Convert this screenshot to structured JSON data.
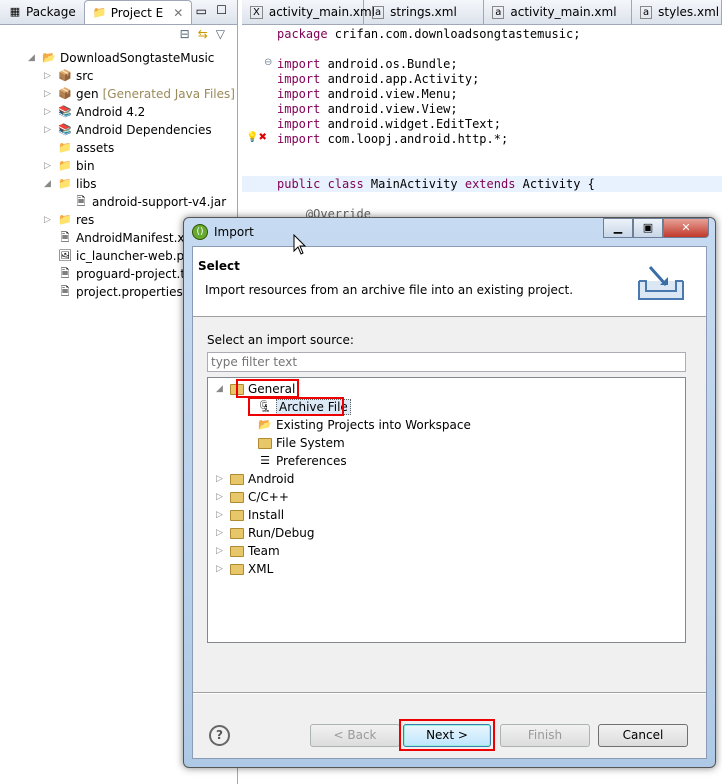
{
  "left_panel": {
    "tabs": [
      "Package",
      "Project E"
    ],
    "tree": [
      {
        "label": "DownloadSongtasteMusic",
        "depth": 0,
        "twisty": "open",
        "icon": "project-icon"
      },
      {
        "label": "src",
        "depth": 1,
        "twisty": "closed",
        "icon": "package-folder-icon"
      },
      {
        "label": "gen",
        "suffix": "[Generated Java Files]",
        "depth": 1,
        "twisty": "closed",
        "icon": "package-folder-icon"
      },
      {
        "label": "Android 4.2",
        "depth": 1,
        "twisty": "closed",
        "icon": "library-icon"
      },
      {
        "label": "Android Dependencies",
        "depth": 1,
        "twisty": "closed",
        "icon": "library-icon"
      },
      {
        "label": "assets",
        "depth": 1,
        "twisty": "",
        "icon": "folder-icon"
      },
      {
        "label": "bin",
        "depth": 1,
        "twisty": "closed",
        "icon": "folder-icon"
      },
      {
        "label": "libs",
        "depth": 1,
        "twisty": "open",
        "icon": "folder-icon"
      },
      {
        "label": "android-support-v4.jar",
        "depth": 2,
        "twisty": "",
        "icon": "jar-icon"
      },
      {
        "label": "res",
        "depth": 1,
        "twisty": "closed",
        "icon": "folder-icon"
      },
      {
        "label": "AndroidManifest.xml",
        "depth": 1,
        "twisty": "",
        "icon": "xml-file-icon"
      },
      {
        "label": "ic_launcher-web.png",
        "depth": 1,
        "twisty": "",
        "icon": "image-file-icon"
      },
      {
        "label": "proguard-project.txt",
        "depth": 1,
        "twisty": "",
        "icon": "text-file-icon"
      },
      {
        "label": "project.properties",
        "depth": 1,
        "twisty": "",
        "icon": "text-file-icon"
      }
    ]
  },
  "editor": {
    "tabs": [
      "activity_main.xml",
      "strings.xml",
      "activity_main.xml",
      "styles.xml"
    ],
    "lines": [
      {
        "kw": "package",
        "rest": " crifan.com.downloadsongtastemusic;"
      },
      {
        "kw": "import",
        "rest": " android.os.Bundle;"
      },
      {
        "kw": "import",
        "rest": " android.app.Activity;"
      },
      {
        "kw": "import",
        "rest": " android.view.Menu;"
      },
      {
        "kw": "import",
        "rest": " android.view.View;"
      },
      {
        "kw": "import",
        "rest": " android.widget.EditText;"
      },
      {
        "kw": "import",
        "rest": " com.loopj.android.http.*;"
      },
      {
        "kw": "public class",
        "rest": " MainActivity ",
        "kw2": "extends",
        "rest2": " Activity {"
      },
      {
        "kw": "",
        "rest": "    @Override"
      }
    ]
  },
  "dialog": {
    "title": "Import",
    "header": "Select",
    "description": "Import resources from an archive file into an existing project.",
    "source_label": "Select an import source:",
    "filter_placeholder": "type filter text",
    "tree": [
      {
        "label": "General",
        "depth": 0,
        "twisty": "open",
        "icon": "folder-icon",
        "highlight": true
      },
      {
        "label": "Archive File",
        "depth": 1,
        "icon": "archive-icon",
        "selected": true
      },
      {
        "label": "Existing Projects into Workspace",
        "depth": 1,
        "icon": "projects-icon"
      },
      {
        "label": "File System",
        "depth": 1,
        "icon": "folder-icon"
      },
      {
        "label": "Preferences",
        "depth": 1,
        "icon": "preferences-icon"
      },
      {
        "label": "Android",
        "depth": 0,
        "twisty": "closed",
        "icon": "folder-icon"
      },
      {
        "label": "C/C++",
        "depth": 0,
        "twisty": "closed",
        "icon": "folder-icon"
      },
      {
        "label": "Install",
        "depth": 0,
        "twisty": "closed",
        "icon": "folder-icon"
      },
      {
        "label": "Run/Debug",
        "depth": 0,
        "twisty": "closed",
        "icon": "folder-icon"
      },
      {
        "label": "Team",
        "depth": 0,
        "twisty": "closed",
        "icon": "folder-icon"
      },
      {
        "label": "XML",
        "depth": 0,
        "twisty": "closed",
        "icon": "folder-icon"
      }
    ],
    "buttons": {
      "back": "< Back",
      "next": "Next >",
      "finish": "Finish",
      "cancel": "Cancel"
    }
  }
}
